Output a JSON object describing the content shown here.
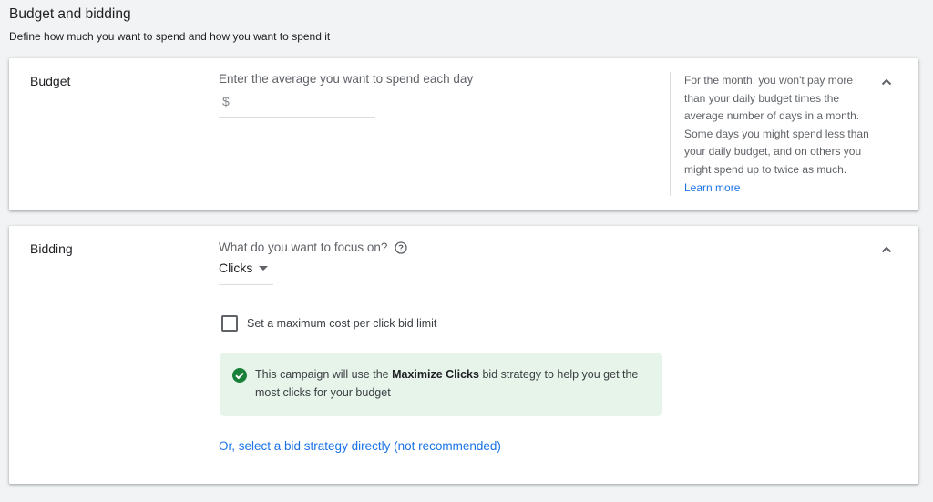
{
  "header": {
    "title": "Budget and bidding",
    "subtitle": "Define how much you want to spend and how you want to spend it"
  },
  "budget": {
    "title": "Budget",
    "field_label": "Enter the average you want to spend each day",
    "currency_symbol": "$",
    "input_value": "",
    "help_text": "For the month, you won't pay more than your daily budget times the average number of days in a month. Some days you might spend less than your daily budget, and on others you might spend up to twice as much.",
    "learn_more": "Learn more",
    "collapse_icon": "chevron-up-icon"
  },
  "bidding": {
    "title": "Bidding",
    "focus_label": "What do you want to focus on?",
    "focus_value": "Clicks",
    "checkbox_label": "Set a maximum cost per click bid limit",
    "checkbox_checked": false,
    "info_prefix": "This campaign will use the ",
    "info_bold": "Maximize Clicks",
    "info_suffix": " bid strategy to help you get the most clicks for your budget",
    "strategy_link": "Or, select a bid strategy directly (not recommended)",
    "collapse_icon": "chevron-up-icon"
  },
  "colors": {
    "link": "#1a73e8",
    "success_bg": "#e6f4ea",
    "success_icon": "#188038"
  }
}
